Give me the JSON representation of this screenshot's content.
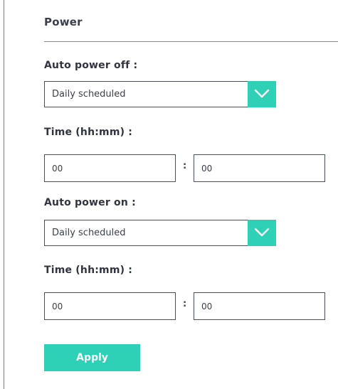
{
  "power": {
    "title": "Power",
    "auto_off": {
      "label": "Auto power off :",
      "mode": "Daily scheduled",
      "time_label": "Time (hh:mm) :",
      "hour": "00",
      "separator": ":",
      "minute": "00"
    },
    "auto_on": {
      "label": "Auto power on :",
      "mode": "Daily scheduled",
      "time_label": "Time (hh:mm) :",
      "hour": "00",
      "separator": ":",
      "minute": "00"
    },
    "apply_label": "Apply"
  },
  "colors": {
    "accent": "#2fd1b6",
    "border": "#4a4f5a",
    "text": "#2f3440"
  },
  "icons": {
    "dropdown": "chevron-down-icon"
  }
}
